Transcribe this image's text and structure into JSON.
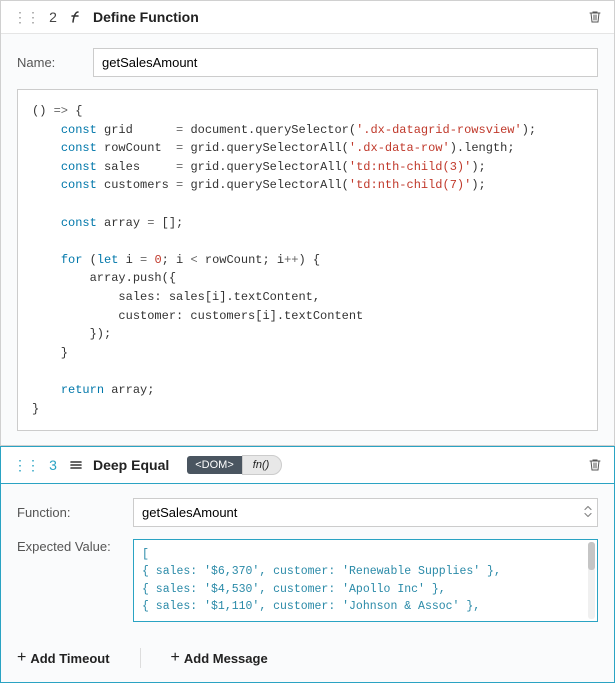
{
  "step1": {
    "number": "2",
    "title": "Define Function",
    "name_label": "Name:",
    "name_value": "getSalesAmount",
    "code_lines": [
      {
        "segments": [
          {
            "t": "() "
          },
          {
            "t": "=>",
            "c": "paren"
          },
          {
            "t": " {"
          }
        ]
      },
      {
        "segments": [
          {
            "t": "    "
          },
          {
            "t": "const",
            "c": "kw"
          },
          {
            "t": " grid      "
          },
          {
            "t": "=",
            "c": "paren"
          },
          {
            "t": " document.querySelector("
          },
          {
            "t": "'.dx-datagrid-rowsview'",
            "c": "str"
          },
          {
            "t": ");"
          }
        ]
      },
      {
        "segments": [
          {
            "t": "    "
          },
          {
            "t": "const",
            "c": "kw"
          },
          {
            "t": " rowCount  "
          },
          {
            "t": "=",
            "c": "paren"
          },
          {
            "t": " grid.querySelectorAll("
          },
          {
            "t": "'.dx-data-row'",
            "c": "str"
          },
          {
            "t": ").length;"
          }
        ]
      },
      {
        "segments": [
          {
            "t": "    "
          },
          {
            "t": "const",
            "c": "kw"
          },
          {
            "t": " sales     "
          },
          {
            "t": "=",
            "c": "paren"
          },
          {
            "t": " grid.querySelectorAll("
          },
          {
            "t": "'td:nth-child(3)'",
            "c": "str"
          },
          {
            "t": ");"
          }
        ]
      },
      {
        "segments": [
          {
            "t": "    "
          },
          {
            "t": "const",
            "c": "kw"
          },
          {
            "t": " customers "
          },
          {
            "t": "=",
            "c": "paren"
          },
          {
            "t": " grid.querySelectorAll("
          },
          {
            "t": "'td:nth-child(7)'",
            "c": "str"
          },
          {
            "t": ");"
          }
        ]
      },
      {
        "segments": [
          {
            "t": " "
          }
        ]
      },
      {
        "segments": [
          {
            "t": "    "
          },
          {
            "t": "const",
            "c": "kw"
          },
          {
            "t": " array "
          },
          {
            "t": "=",
            "c": "paren"
          },
          {
            "t": " [];"
          }
        ]
      },
      {
        "segments": [
          {
            "t": " "
          }
        ]
      },
      {
        "segments": [
          {
            "t": "    "
          },
          {
            "t": "for",
            "c": "kw"
          },
          {
            "t": " ("
          },
          {
            "t": "let",
            "c": "kw"
          },
          {
            "t": " i "
          },
          {
            "t": "=",
            "c": "paren"
          },
          {
            "t": " "
          },
          {
            "t": "0",
            "c": "num"
          },
          {
            "t": "; i "
          },
          {
            "t": "<",
            "c": "paren"
          },
          {
            "t": " rowCount; i"
          },
          {
            "t": "++",
            "c": "paren"
          },
          {
            "t": ") {"
          }
        ]
      },
      {
        "segments": [
          {
            "t": "        array.push({"
          }
        ]
      },
      {
        "segments": [
          {
            "t": "            sales: sales[i].textContent,"
          }
        ]
      },
      {
        "segments": [
          {
            "t": "            customer: customers[i].textContent"
          }
        ]
      },
      {
        "segments": [
          {
            "t": "        });"
          }
        ]
      },
      {
        "segments": [
          {
            "t": "    }"
          }
        ]
      },
      {
        "segments": [
          {
            "t": " "
          }
        ]
      },
      {
        "segments": [
          {
            "t": "    "
          },
          {
            "t": "return",
            "c": "kw"
          },
          {
            "t": " array;"
          }
        ]
      },
      {
        "segments": [
          {
            "t": "}"
          }
        ]
      }
    ]
  },
  "step2": {
    "number": "3",
    "title": "Deep Equal",
    "tag_dom": "<DOM>",
    "tag_fn": "fn()",
    "function_label": "Function:",
    "function_value": "getSalesAmount",
    "expected_label": "Expected Value:",
    "expected_lines": [
      "[",
      "  { sales: '$6,370', customer: 'Renewable Supplies' },",
      "  { sales: '$4,530', customer: 'Apollo Inc' },",
      "  { sales: '$1,110', customer: 'Johnson & Assoc' },"
    ],
    "add_timeout": "Add Timeout",
    "add_message": "Add Message"
  }
}
